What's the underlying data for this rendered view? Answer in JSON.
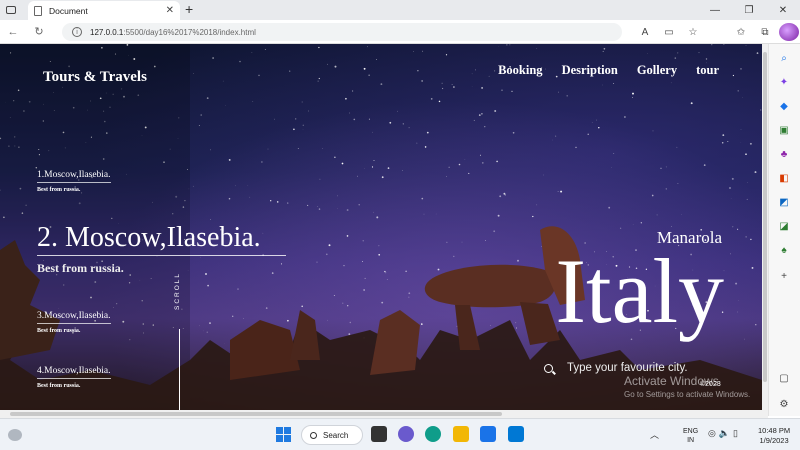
{
  "browser": {
    "tab_title": "Document",
    "url_host": "127.0.0.1",
    "url_path": ":5500/day16%2017%2018/index.html"
  },
  "site": {
    "logo": "Tours & Travels",
    "menu": [
      "Booking",
      "Desription",
      "Gollery",
      "tour"
    ],
    "slides": [
      {
        "title": "1.Moscow,Ilasebia.",
        "sub": "Best from russia."
      },
      {
        "title": "2. Moscow,Ilasebia.",
        "sub": "Best from russia."
      },
      {
        "title": "3.Moscow,Ilasebia.",
        "sub": "Best from russia."
      },
      {
        "title": "4.Moscow,Ilasebia.",
        "sub": "Best from russia."
      }
    ],
    "scroll_label": "SCROLL",
    "city_small": "Manarola",
    "city_big": "Italy",
    "search_placeholder": "Type your favourite city.",
    "copyright": "©2023"
  },
  "watermark": {
    "line1": "Activate Windows",
    "line2": "Go to Settings to activate Windows."
  },
  "taskbar": {
    "search_label": "Search",
    "lang_line1": "ENG",
    "lang_line2": "IN",
    "time": "10:48 PM",
    "date": "1/9/2023"
  }
}
